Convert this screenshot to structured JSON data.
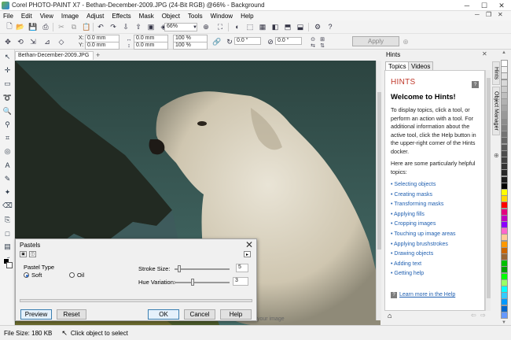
{
  "window": {
    "title": "Corel PHOTO-PAINT X7 - Bethan-December-2009.JPG (24-Bit RGB) @66% - Background",
    "controls": {
      "minimize": "─",
      "maximize": "☐",
      "close": "✕"
    }
  },
  "menu": {
    "items": [
      "File",
      "Edit",
      "View",
      "Image",
      "Adjust",
      "Effects",
      "Mask",
      "Object",
      "Tools",
      "Window",
      "Help"
    ],
    "doc_controls": [
      "─",
      "❐",
      "✕"
    ]
  },
  "toolbar1": {
    "zoom": "66%"
  },
  "toolbar2": {
    "x_label": "X:",
    "x_value": "0.0 mm",
    "y_label": "Y:",
    "y_value": "0.0 mm",
    "w_value": "0.0 mm",
    "h_value": "0.0 mm",
    "scale_w": "100 %",
    "scale_h": "100 %",
    "angle1": "0.0 °",
    "angle2": "0.0 °",
    "apply_label": "Apply"
  },
  "document": {
    "tab_label": "Bethan-December-2009.JPG",
    "add_tab": "+",
    "preview_text": "your image"
  },
  "hints": {
    "panel_title": "Hints",
    "tabs": [
      "Topics",
      "Videos"
    ],
    "heading": "HINTS",
    "welcome": "Welcome to Hints!",
    "para1": "To display topics, click a tool, or perform an action with a tool. For additional information about the active tool, click the Help button in the upper-right corner of the Hints docker.",
    "para2": "Here are some particularly helpful topics:",
    "links": [
      "Selecting objects",
      "Creating masks",
      "Transforming masks",
      "Applying fills",
      "Cropping images",
      "Touching up image areas",
      "Applying brushstrokes",
      "Drawing objects",
      "Adding text",
      "Getting help"
    ],
    "learn_more": "Learn more in the Help",
    "side_tabs": [
      "Hints",
      "Object Manager"
    ]
  },
  "palette": {
    "colors": [
      "#ffffff",
      "#f2f2f2",
      "#e5e5e5",
      "#d9d9d9",
      "#cccccc",
      "#bfbfbf",
      "#b2b2b2",
      "#a6a6a6",
      "#999999",
      "#8c8c8c",
      "#808080",
      "#737373",
      "#666666",
      "#595959",
      "#4d4d4d",
      "#404040",
      "#333333",
      "#262626",
      "#1a1a1a",
      "#000000",
      "#ffff00",
      "#ffd700",
      "#ff0000",
      "#e4007f",
      "#c000c0",
      "#8b00ff",
      "#ff66cc",
      "#ffcc99",
      "#ff9900",
      "#cc6600",
      "#996633",
      "#00c000",
      "#00a000",
      "#00ff00",
      "#99ff66",
      "#00ffff",
      "#33ccff",
      "#0099ff",
      "#0066cc",
      "#6699ff"
    ]
  },
  "statusbar": {
    "file_size": "File Size: 180 KB",
    "hint": "Click object to select"
  },
  "dialog": {
    "title": "Pastels",
    "close": "✕",
    "pastel_type_label": "Pastel Type",
    "soft_label": "Soft",
    "oil_label": "Oil",
    "selected_type": "Soft",
    "stroke_size_label": "Stroke Size:",
    "stroke_size_value": "5",
    "hue_variation_label": "Hue Variation:",
    "hue_variation_value": "3",
    "stroke_size_fraction": 0.05,
    "hue_variation_fraction": 0.3,
    "buttons": {
      "preview": "Preview",
      "reset": "Reset",
      "ok": "OK",
      "cancel": "Cancel",
      "help": "Help"
    }
  }
}
